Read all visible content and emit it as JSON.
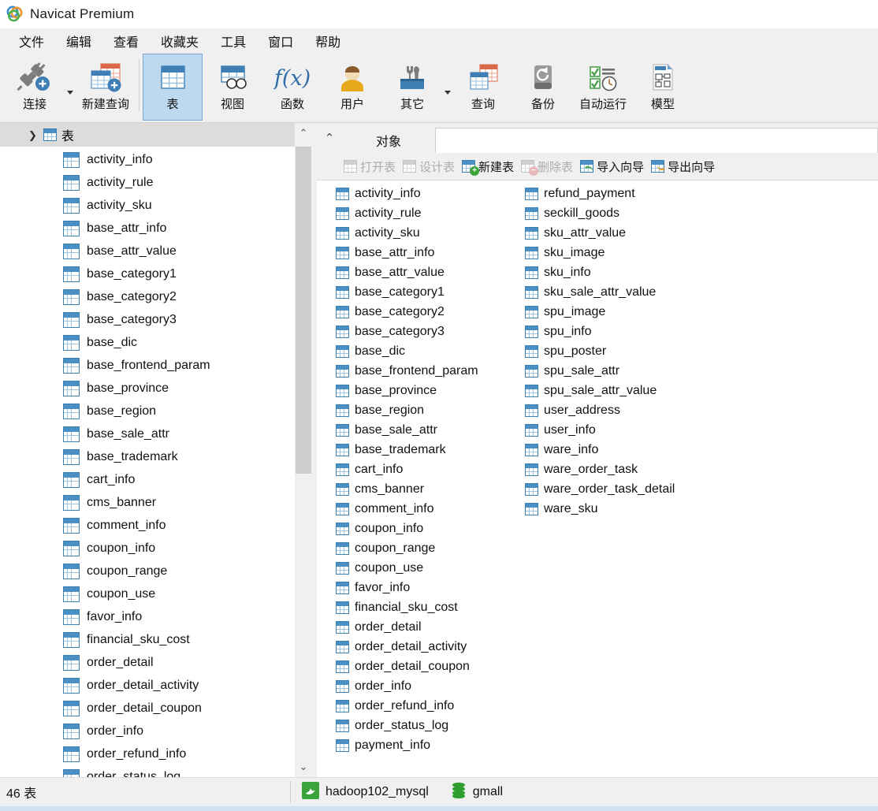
{
  "window": {
    "title": "Navicat Premium",
    "logo_icon": "navicat-logo-icon"
  },
  "menubar": {
    "items": [
      {
        "label": "文件",
        "name": "menu-file"
      },
      {
        "label": "编辑",
        "name": "menu-edit"
      },
      {
        "label": "查看",
        "name": "menu-view"
      },
      {
        "label": "收藏夹",
        "name": "menu-favorites"
      },
      {
        "label": "工具",
        "name": "menu-tools"
      },
      {
        "label": "窗口",
        "name": "menu-window"
      },
      {
        "label": "帮助",
        "name": "menu-help"
      }
    ]
  },
  "ribbon": {
    "items": [
      {
        "label": "连接",
        "icon": "connection-icon",
        "has_dropdown": true,
        "selected": false
      },
      {
        "label": "新建查询",
        "icon": "new-query-icon",
        "has_dropdown": false,
        "selected": false
      },
      {
        "label": "表",
        "icon": "table-icon",
        "has_dropdown": false,
        "selected": true
      },
      {
        "label": "视图",
        "icon": "view-icon",
        "has_dropdown": false,
        "selected": false
      },
      {
        "label": "函数",
        "icon": "function-icon",
        "has_dropdown": false,
        "selected": false
      },
      {
        "label": "用户",
        "icon": "user-icon",
        "has_dropdown": false,
        "selected": false
      },
      {
        "label": "其它",
        "icon": "other-tools-icon",
        "has_dropdown": true,
        "selected": false
      },
      {
        "label": "查询",
        "icon": "query-icon",
        "has_dropdown": false,
        "selected": false
      },
      {
        "label": "备份",
        "icon": "backup-icon",
        "has_dropdown": false,
        "selected": false
      },
      {
        "label": "自动运行",
        "icon": "automation-icon",
        "has_dropdown": false,
        "selected": false
      },
      {
        "label": "模型",
        "icon": "model-icon",
        "has_dropdown": false,
        "selected": false
      }
    ]
  },
  "sidebar": {
    "header": {
      "label": "表",
      "icon": "table-icon",
      "expand_icon": "chevron-down-icon",
      "expanded": true
    },
    "scroll_up_icon": "chevron-up-icon",
    "scroll_down_icon": "chevron-down-icon",
    "items": [
      "activity_info",
      "activity_rule",
      "activity_sku",
      "base_attr_info",
      "base_attr_value",
      "base_category1",
      "base_category2",
      "base_category3",
      "base_dic",
      "base_frontend_param",
      "base_province",
      "base_region",
      "base_sale_attr",
      "base_trademark",
      "cart_info",
      "cms_banner",
      "comment_info",
      "coupon_info",
      "coupon_range",
      "coupon_use",
      "favor_info",
      "financial_sku_cost",
      "order_detail",
      "order_detail_activity",
      "order_detail_coupon",
      "order_info",
      "order_refund_info",
      "order_status_log"
    ]
  },
  "object_panel": {
    "collapse_icon": "chevron-up-icon",
    "tab": {
      "label": "对象",
      "name": "tab-objects"
    },
    "toolbar": [
      {
        "label": "打开表",
        "icon": "open-table-icon",
        "enabled": false
      },
      {
        "label": "设计表",
        "icon": "design-table-icon",
        "enabled": false
      },
      {
        "label": "新建表",
        "icon": "new-table-icon",
        "enabled": true
      },
      {
        "label": "删除表",
        "icon": "delete-table-icon",
        "enabled": false
      },
      {
        "label": "导入向导",
        "icon": "import-wizard-icon",
        "enabled": true
      },
      {
        "label": "导出向导",
        "icon": "export-wizard-icon",
        "enabled": true
      }
    ],
    "column1": [
      "activity_info",
      "activity_rule",
      "activity_sku",
      "base_attr_info",
      "base_attr_value",
      "base_category1",
      "base_category2",
      "base_category3",
      "base_dic",
      "base_frontend_param",
      "base_province",
      "base_region",
      "base_sale_attr",
      "base_trademark",
      "cart_info",
      "cms_banner",
      "comment_info",
      "coupon_info",
      "coupon_range",
      "coupon_use",
      "favor_info",
      "financial_sku_cost",
      "order_detail",
      "order_detail_activity",
      "order_detail_coupon",
      "order_info",
      "order_refund_info",
      "order_status_log",
      "payment_info"
    ],
    "column2": [
      "refund_payment",
      "seckill_goods",
      "sku_attr_value",
      "sku_image",
      "sku_info",
      "sku_sale_attr_value",
      "spu_image",
      "spu_info",
      "spu_poster",
      "spu_sale_attr",
      "spu_sale_attr_value",
      "user_address",
      "user_info",
      "ware_info",
      "ware_order_task",
      "ware_order_task_detail",
      "ware_sku"
    ]
  },
  "statusbar": {
    "count_label": "46 表",
    "connection": {
      "label": "hadoop102_mysql",
      "icon": "mysql-dolphin-icon"
    },
    "database": {
      "label": "gmall",
      "icon": "database-icon"
    }
  },
  "colors": {
    "accent_blue": "#4a90c4",
    "selection_blue": "#bcd9ef",
    "chrome_gray": "#f0f0f0",
    "tree_header_gray": "#dcdcdc",
    "mysql_green": "#3aa33a",
    "disabled_gray": "#adadad"
  }
}
